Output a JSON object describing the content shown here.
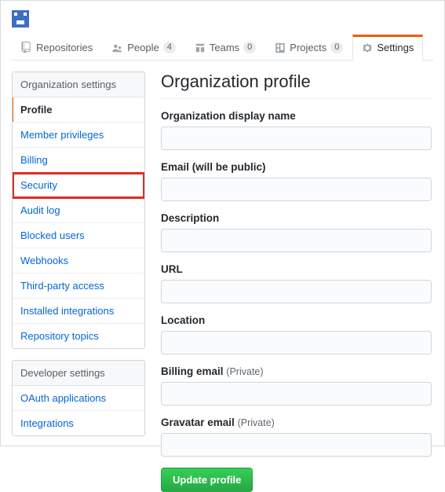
{
  "tabs": {
    "repos": {
      "label": "Repositories"
    },
    "people": {
      "label": "People",
      "count": "4"
    },
    "teams": {
      "label": "Teams",
      "count": "0"
    },
    "projects": {
      "label": "Projects",
      "count": "0"
    },
    "settings": {
      "label": "Settings"
    }
  },
  "sidebar": {
    "org_header": "Organization settings",
    "items": [
      "Profile",
      "Member privileges",
      "Billing",
      "Security",
      "Audit log",
      "Blocked users",
      "Webhooks",
      "Third-party access",
      "Installed integrations",
      "Repository topics"
    ],
    "dev_header": "Developer settings",
    "dev_items": [
      "OAuth applications",
      "Integrations"
    ]
  },
  "main": {
    "title": "Organization profile",
    "fields": {
      "display_name": {
        "label": "Organization display name",
        "value": ""
      },
      "email": {
        "label": "Email (will be public)",
        "value": ""
      },
      "description": {
        "label": "Description",
        "value": ""
      },
      "url": {
        "label": "URL",
        "value": ""
      },
      "location": {
        "label": "Location",
        "value": ""
      },
      "billing_email": {
        "label": "Billing email",
        "suffix": "(Private)",
        "value": ""
      },
      "gravatar_email": {
        "label": "Gravatar email",
        "suffix": "(Private)",
        "value": ""
      }
    },
    "submit_label": "Update profile"
  }
}
